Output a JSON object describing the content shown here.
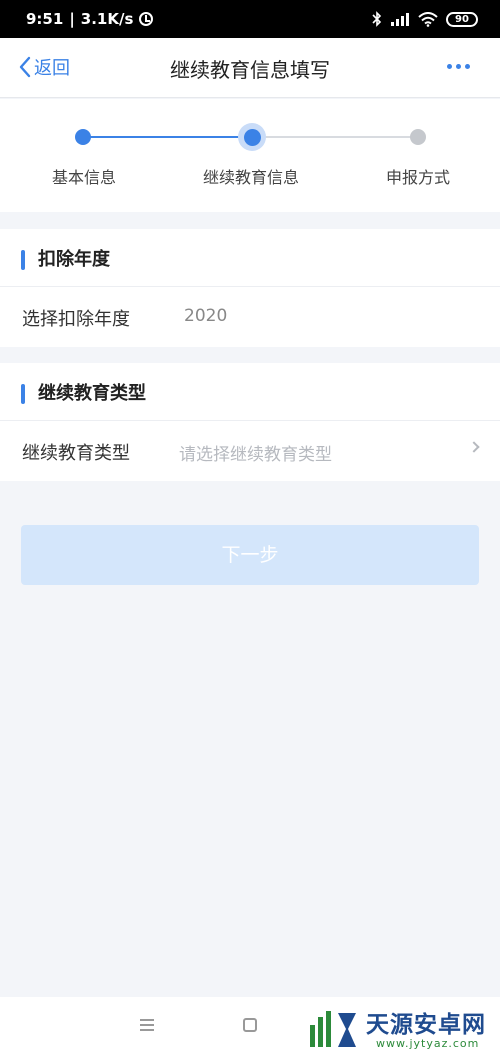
{
  "status_bar": {
    "time": "9:51",
    "network_speed": "3.1K/s",
    "battery": "90"
  },
  "nav": {
    "back_label": "返回",
    "title": "继续教育信息填写"
  },
  "steps": [
    {
      "label": "基本信息",
      "state": "done"
    },
    {
      "label": "继续教育信息",
      "state": "active"
    },
    {
      "label": "申报方式",
      "state": "pending"
    }
  ],
  "deduction_year": {
    "title": "扣除年度",
    "field_label": "选择扣除年度",
    "value": "2020"
  },
  "education_type": {
    "title": "继续教育类型",
    "field_label": "继续教育类型",
    "placeholder": "请选择继续教育类型"
  },
  "next_button": "下一步",
  "watermark": {
    "title": "天源安卓网",
    "url": "www.jytyaz.com"
  },
  "colors": {
    "accent": "#3b82e6",
    "button_disabled": "#d4e6fb",
    "page_background": "#f3f5f9"
  }
}
